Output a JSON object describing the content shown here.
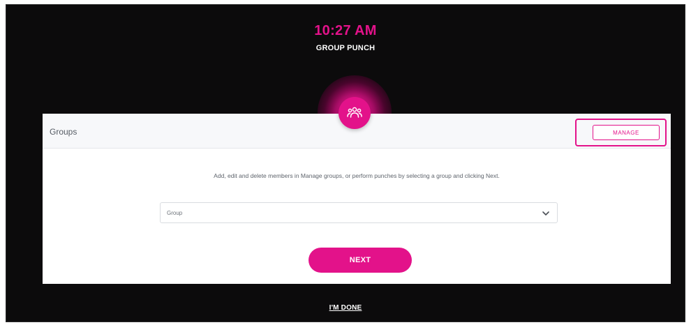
{
  "header": {
    "time": "10:27 AM",
    "subtitle": "GROUP PUNCH"
  },
  "panel": {
    "title": "Groups",
    "manage_label": "MANAGE",
    "instructions": "Add, edit and delete members in Manage groups, or perform punches by selecting a group and clicking Next.",
    "group_select": {
      "value": "Group"
    },
    "next_label": "NEXT"
  },
  "footer": {
    "done_label": "I'M DONE"
  },
  "icons": {
    "center": "group-icon",
    "select": "chevron-down-icon"
  },
  "colors": {
    "accent": "#e3128a",
    "background": "#0c0b0c",
    "panel": "#ffffff"
  }
}
